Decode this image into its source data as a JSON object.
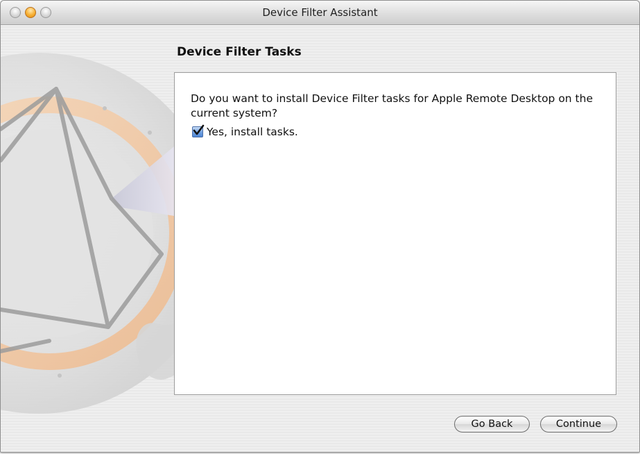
{
  "window": {
    "title": "Device Filter Assistant"
  },
  "main": {
    "heading": "Device Filter Tasks",
    "question": "Do you want to install Device Filter tasks for Apple Remote Desktop on the current system?",
    "checkbox": {
      "label": "Yes, install tasks.",
      "checked": true
    }
  },
  "buttons": {
    "back_label": "Go Back",
    "continue_label": "Continue"
  },
  "colors": {
    "accent": "#5b8fd8",
    "art_orange": "#f3c9a2"
  },
  "icons": {
    "background_art": "remote-desktop-telescope-art"
  }
}
